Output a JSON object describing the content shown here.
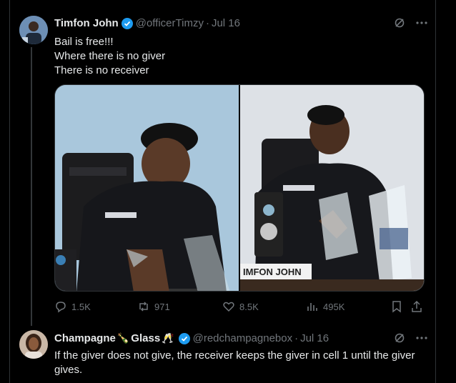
{
  "tweet": {
    "author_name": "Timfon John",
    "author_handle": "@officerTimzy",
    "date": "Jul 16",
    "lines": [
      "Bail is free!!!",
      "Where there is no giver",
      "There is no receiver"
    ],
    "photo_nameplate": "IMFON JOHN",
    "stats": {
      "replies": "1.5K",
      "reposts": "971",
      "likes": "8.5K",
      "views": "495K"
    }
  },
  "reply": {
    "author_name_part1": "Champagne",
    "author_name_part2": "Glass",
    "author_handle": "@redchampagnebox",
    "date": "Jul 16",
    "text": "If the giver does not give, the receiver keeps the giver in cell 1 until the giver gives."
  },
  "colors": {
    "background": "#000000",
    "text": "#e7e9ea",
    "muted": "#71767b",
    "verified": "#1d9bf0"
  }
}
